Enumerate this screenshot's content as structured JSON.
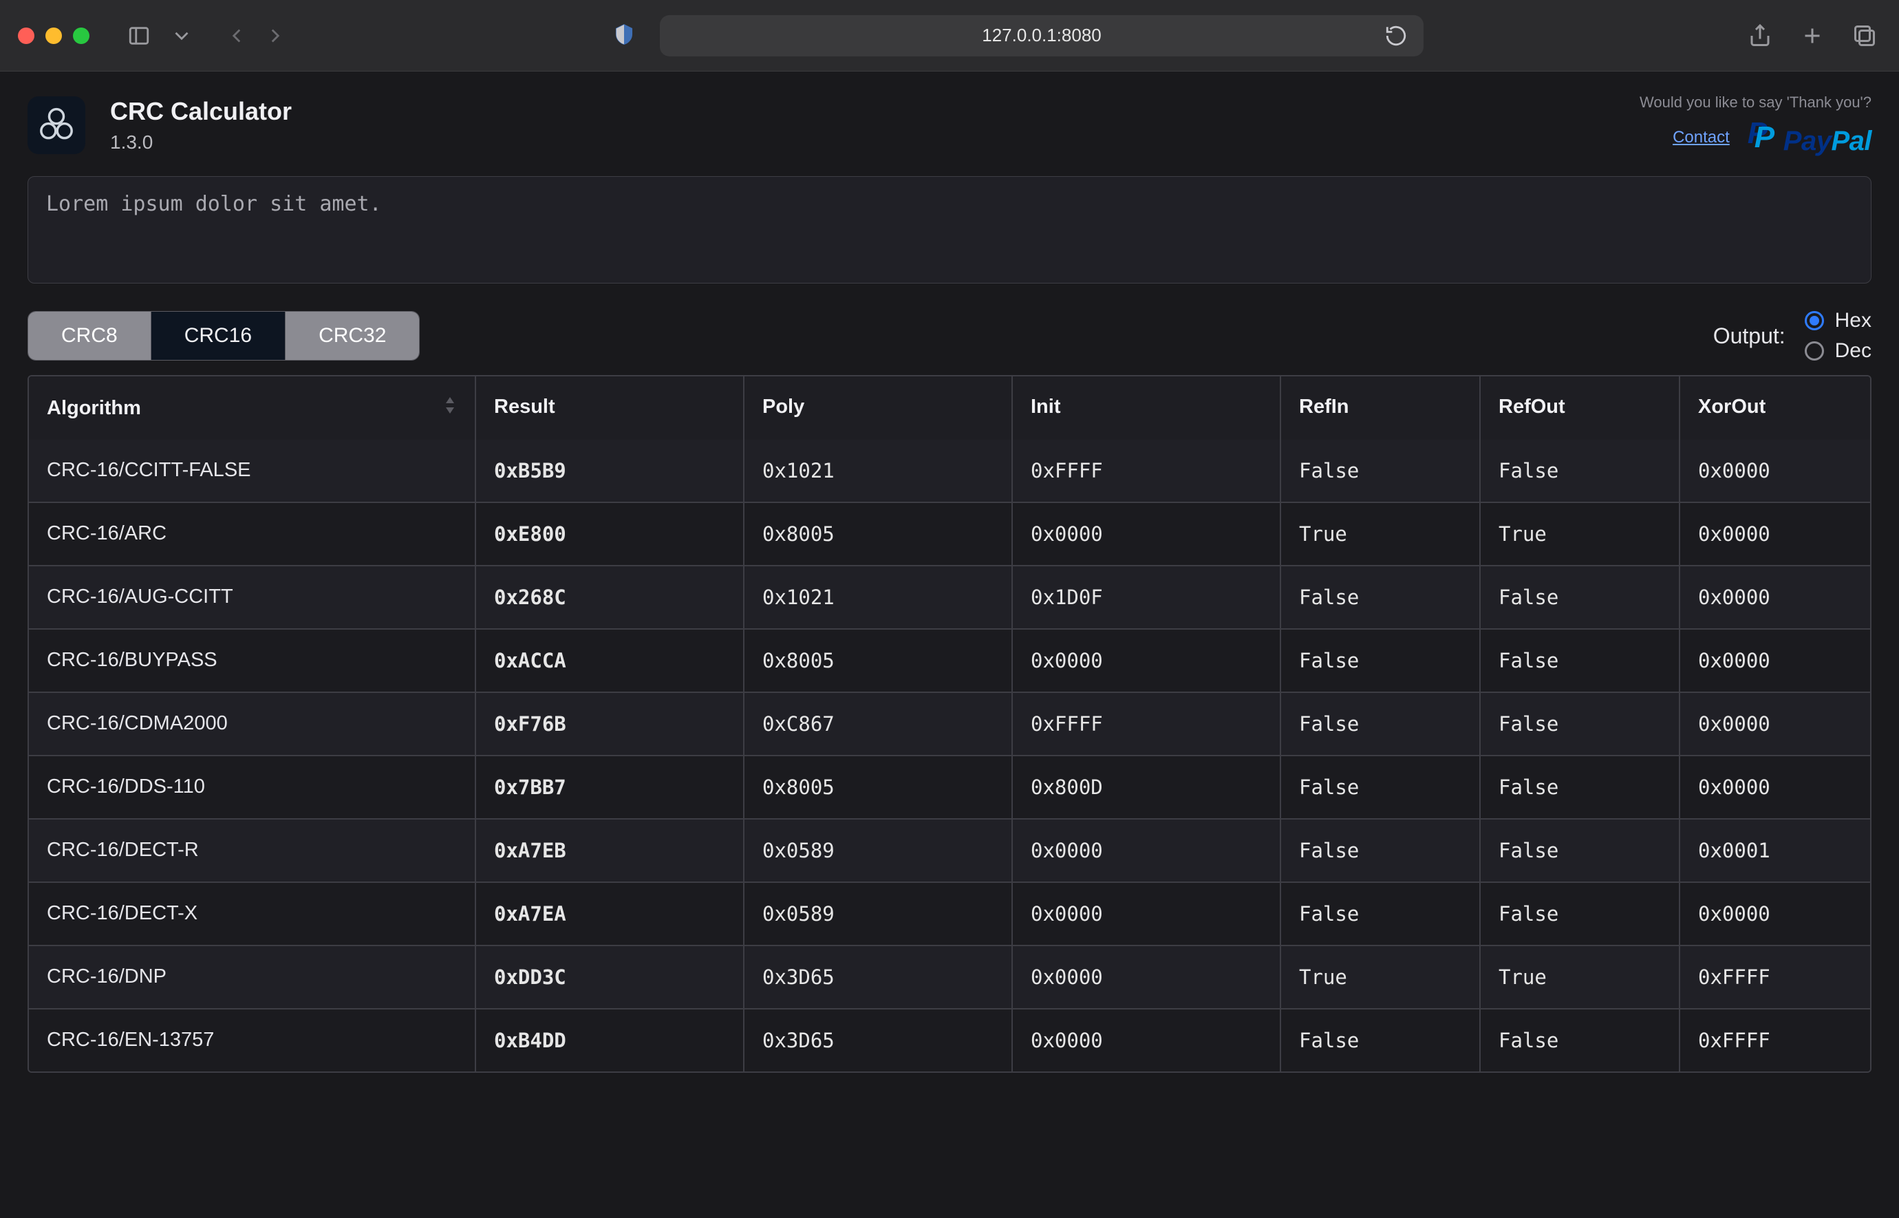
{
  "browser": {
    "url": "127.0.0.1:8080"
  },
  "app": {
    "title": "CRC Calculator",
    "version": "1.3.0",
    "thankyou": "Would you like to say 'Thank you'?",
    "contact": "Contact",
    "paypal_pay": "Pay",
    "paypal_pal": "Pal"
  },
  "input": {
    "value": "Lorem ipsum dolor sit amet."
  },
  "tabs": {
    "items": [
      "CRC8",
      "CRC16",
      "CRC32"
    ],
    "active_index": 1
  },
  "output": {
    "label": "Output:",
    "options": [
      "Hex",
      "Dec"
    ],
    "selected_index": 0
  },
  "table": {
    "headers": [
      "Algorithm",
      "Result",
      "Poly",
      "Init",
      "RefIn",
      "RefOut",
      "XorOut"
    ],
    "rows": [
      {
        "alg": "CRC-16/CCITT-FALSE",
        "result": "0xB5B9",
        "poly": "0x1021",
        "init": "0xFFFF",
        "refin": "False",
        "refout": "False",
        "xorout": "0x0000"
      },
      {
        "alg": "CRC-16/ARC",
        "result": "0xE800",
        "poly": "0x8005",
        "init": "0x0000",
        "refin": "True",
        "refout": "True",
        "xorout": "0x0000"
      },
      {
        "alg": "CRC-16/AUG-CCITT",
        "result": "0x268C",
        "poly": "0x1021",
        "init": "0x1D0F",
        "refin": "False",
        "refout": "False",
        "xorout": "0x0000"
      },
      {
        "alg": "CRC-16/BUYPASS",
        "result": "0xACCA",
        "poly": "0x8005",
        "init": "0x0000",
        "refin": "False",
        "refout": "False",
        "xorout": "0x0000"
      },
      {
        "alg": "CRC-16/CDMA2000",
        "result": "0xF76B",
        "poly": "0xC867",
        "init": "0xFFFF",
        "refin": "False",
        "refout": "False",
        "xorout": "0x0000"
      },
      {
        "alg": "CRC-16/DDS-110",
        "result": "0x7BB7",
        "poly": "0x8005",
        "init": "0x800D",
        "refin": "False",
        "refout": "False",
        "xorout": "0x0000"
      },
      {
        "alg": "CRC-16/DECT-R",
        "result": "0xA7EB",
        "poly": "0x0589",
        "init": "0x0000",
        "refin": "False",
        "refout": "False",
        "xorout": "0x0001"
      },
      {
        "alg": "CRC-16/DECT-X",
        "result": "0xA7EA",
        "poly": "0x0589",
        "init": "0x0000",
        "refin": "False",
        "refout": "False",
        "xorout": "0x0000"
      },
      {
        "alg": "CRC-16/DNP",
        "result": "0xDD3C",
        "poly": "0x3D65",
        "init": "0x0000",
        "refin": "True",
        "refout": "True",
        "xorout": "0xFFFF"
      },
      {
        "alg": "CRC-16/EN-13757",
        "result": "0xB4DD",
        "poly": "0x3D65",
        "init": "0x0000",
        "refin": "False",
        "refout": "False",
        "xorout": "0xFFFF"
      }
    ]
  }
}
